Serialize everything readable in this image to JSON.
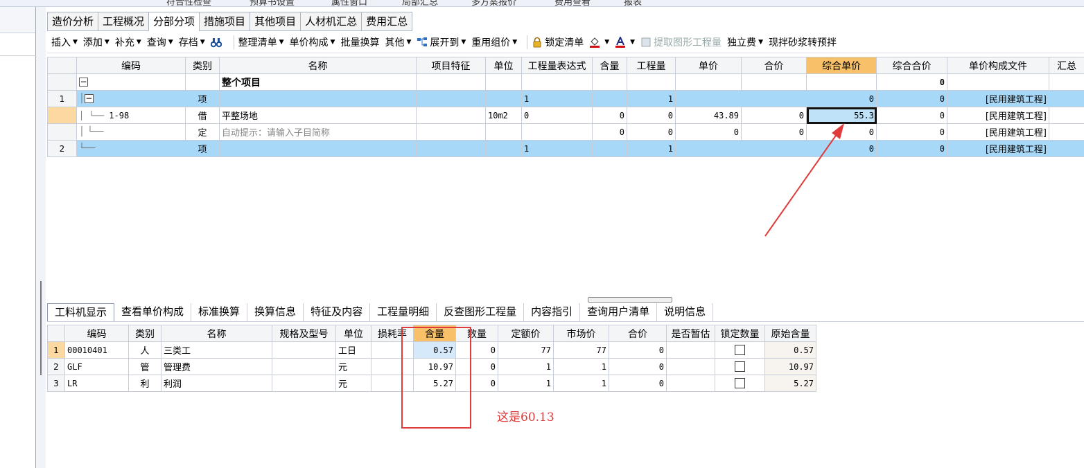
{
  "top_toolbar": {
    "items": [
      "符合性检查",
      "预算书设置",
      "属性窗口",
      "局部汇总",
      "多方案报价",
      "费用查看",
      "报表"
    ]
  },
  "main_tabs": [
    "造价分析",
    "工程概况",
    "分部分项",
    "措施项目",
    "其他项目",
    "人材机汇总",
    "费用汇总"
  ],
  "active_tab": "分部分项",
  "toolbar": {
    "insert": "插入",
    "add": "添加",
    "supplement": "补充",
    "query": "查询",
    "archive": "存档",
    "organize": "整理清单",
    "unit_price_composition": "单价构成",
    "batch_convert": "批量换算",
    "other": "其他",
    "expand_to": "展开到",
    "reuse_price": "重用组价",
    "lock_list": "锁定清单",
    "extract_quantity": "提取图形工程量",
    "independent_fee": "独立费",
    "mortar_convert": "现拌砂浆转预拌"
  },
  "upper_table": {
    "headers": [
      "编码",
      "类别",
      "名称",
      "项目特征",
      "单位",
      "工程量表达式",
      "含量",
      "工程量",
      "单价",
      "合价",
      "综合单价",
      "综合合价",
      "单价构成文件",
      "汇总"
    ],
    "highlight_header": "综合单价",
    "rows": [
      {
        "num": "",
        "code": "",
        "type": "",
        "name": "整个项目",
        "unit": "",
        "expr": "",
        "content": "",
        "qty": "",
        "price": "",
        "total": "",
        "comp_price": "",
        "comp_total": "0",
        "file": ""
      },
      {
        "num": "1",
        "code": "",
        "type": "项",
        "name": "",
        "unit": "",
        "expr": "1",
        "content": "",
        "qty": "1",
        "price": "",
        "total": "",
        "comp_price": "0",
        "comp_total": "0",
        "file": "[民用建筑工程]"
      },
      {
        "num": "",
        "code": "1-98",
        "type": "借",
        "name": "平整场地",
        "unit": "10m2",
        "expr": "0",
        "content": "0",
        "qty": "0",
        "price": "43.89",
        "total": "0",
        "comp_price": "55.3",
        "comp_total": "0",
        "file": "[民用建筑工程]"
      },
      {
        "num": "",
        "code": "",
        "type": "定",
        "name": "自动提示：请输入子目简称",
        "unit": "",
        "expr": "",
        "content": "0",
        "qty": "0",
        "price": "0",
        "total": "0",
        "comp_price": "0",
        "comp_total": "0",
        "file": "[民用建筑工程]"
      },
      {
        "num": "2",
        "code": "",
        "type": "项",
        "name": "",
        "unit": "",
        "expr": "1",
        "content": "",
        "qty": "1",
        "price": "",
        "total": "",
        "comp_price": "0",
        "comp_total": "0",
        "file": "[民用建筑工程]"
      }
    ]
  },
  "lower_tabs": [
    "工料机显示",
    "查看单价构成",
    "标准换算",
    "换算信息",
    "特征及内容",
    "工程量明细",
    "反查图形工程量",
    "内容指引",
    "查询用户清单",
    "说明信息"
  ],
  "active_lower_tab": "工料机显示",
  "lower_table": {
    "headers": [
      "编码",
      "类别",
      "名称",
      "规格及型号",
      "单位",
      "损耗率",
      "含量",
      "数量",
      "定额价",
      "市场价",
      "合价",
      "是否暂估",
      "锁定数量",
      "原始含量"
    ],
    "highlight_header": "含量",
    "rows": [
      {
        "num": "1",
        "code": "00010401",
        "type": "人",
        "name": "三类工",
        "spec": "",
        "unit": "工日",
        "loss": "",
        "content": "0.57",
        "qty": "0",
        "quota": "77",
        "market": "77",
        "total": "0",
        "orig": "0.57"
      },
      {
        "num": "2",
        "code": "GLF",
        "type": "管",
        "name": "管理费",
        "spec": "",
        "unit": "元",
        "loss": "",
        "content": "10.97",
        "qty": "0",
        "quota": "1",
        "market": "1",
        "total": "0",
        "orig": "10.97"
      },
      {
        "num": "3",
        "code": "LR",
        "type": "利",
        "name": "利润",
        "spec": "",
        "unit": "元",
        "loss": "",
        "content": "5.27",
        "qty": "0",
        "quota": "1",
        "market": "1",
        "total": "0",
        "orig": "5.27"
      }
    ]
  },
  "annotation": {
    "text": "这是60.13",
    "color": "#e03a3a"
  },
  "colors": {
    "row_highlight": "#a8d8f8",
    "header_highlight": "#f8c068",
    "annotation": "#e03a3a"
  }
}
